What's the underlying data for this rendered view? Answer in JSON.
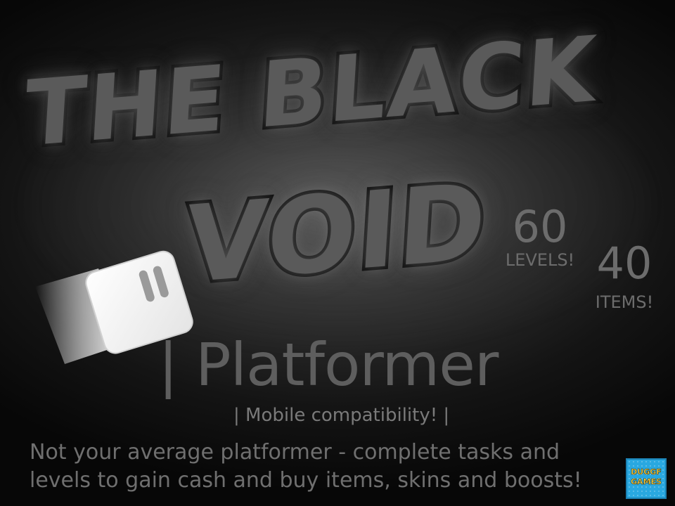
{
  "game": {
    "title_line1": "THE BLACK",
    "title_line2": "VOID",
    "subtitle": "| Platformer",
    "mobile_note": "| Mobile compatibility! |",
    "description_line1": "Not your average platformer - complete tasks and",
    "description_line2": "levels to gain cash and buy items, skins and boosts!"
  },
  "stats": {
    "levels_count": "60",
    "levels_label": "LEVELS!",
    "items_count": "40",
    "items_label": "ITEMS!"
  },
  "logo": {
    "line1": "DUGGF",
    "line2": "GAMES",
    "background_color": "#29a8e0",
    "text_color": "#ffd84a"
  },
  "colors": {
    "background": "#141414",
    "title_fill": "#5a5a5a",
    "title_stroke": "#0c0c0c",
    "text_gray": "#6f6f6f"
  },
  "icons": {
    "cube": "white-cube-character-icon"
  }
}
